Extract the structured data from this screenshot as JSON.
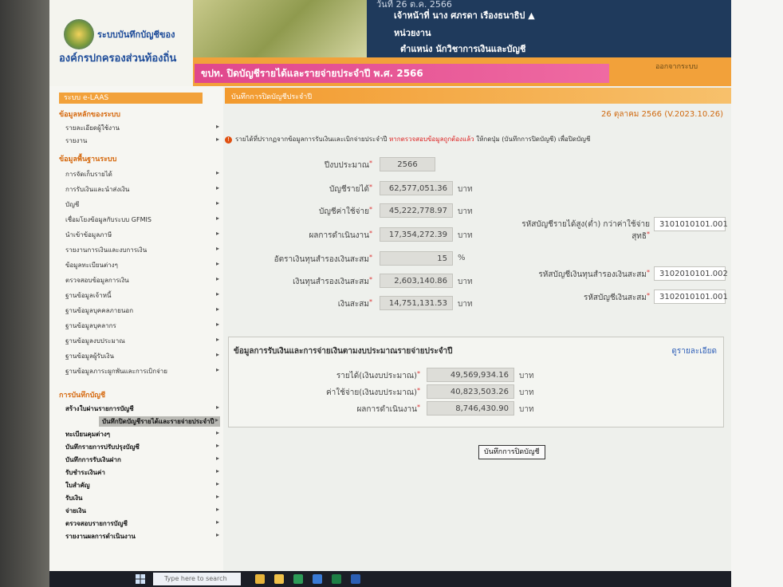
{
  "header": {
    "logo_text_1": "ระบบบันทึกบัญชีของ",
    "logo_text_2": "องค์กรปกครองส่วนท้องถิ่น",
    "user_line_0": "วันที่ 26 ต.ค. 2566",
    "user_name": "เจ้าหน้าที่ นาง ศภรดา เรืองธนาธิป",
    "unit_label": "หน่วยงาน",
    "position": "ตำแหน่ง นักวิชาการเงินและบัญชี",
    "page_title": "ขปท. ปิดบัญชีรายได้และรายจ่ายประจำปี พ.ศ. 2566",
    "right_link": "ออกจากระบบ"
  },
  "sidebar": {
    "top_label": "ระบบ e-LAAS",
    "section_1": "ข้อมูลหลักของระบบ",
    "items_a": [
      "รายละเอียดผู้ใช้งาน",
      "รายงาน"
    ],
    "section_2": "ข้อมูลพื้นฐานระบบ",
    "items_b": [
      "การจัดเก็บรายได้",
      "การรับเงินและนำส่งเงิน",
      "บัญชี",
      "เชื่อมโยงข้อมูลกับระบบ GFMIS",
      "นำเข้าข้อมูลภาษี",
      "รายงานการเงินและงบการเงิน",
      "ข้อมูลทะเบียนต่างๆ",
      "ตรวจสอบข้อมูลการเงิน",
      "ฐานข้อมูลเจ้าหนี้",
      "ฐานข้อมูลบุคคลภายนอก",
      "ฐานข้อมูลบุคลากร",
      "ฐานข้อมูลงบประมาณ",
      "ฐานข้อมูลผู้รับเงิน",
      "ฐานข้อมูลภาระผูกพันและการเบิกจ่าย"
    ],
    "section_3": "การบันทึกบัญชี",
    "items_c": [
      "สร้างใบผ่านรายการบัญชี",
      "บันทึกปิดบัญชีรายได้และรายจ่ายประจำปี",
      "ทะเบียนคุมต่างๆ",
      "บันทึกรายการปรับปรุงบัญชี",
      "บันทึกการรับเงินฝาก",
      "รับชำระเงินค่า",
      "ใบสำคัญ",
      "รับเงิน",
      "จ่ายเงิน",
      "ตรวจสอบรายการบัญชี",
      "รายงานผลการดำเนินงาน"
    ]
  },
  "main": {
    "breadcrumb": "บันทึกการปิดบัญชีประจำปี",
    "date": "26 ตุลาคม 2566 (V.2023.10.26)",
    "warning_text": "รายได้ที่ปรากฏจากข้อมูลการรับเงินและเบิกจ่ายประจำปี",
    "warning_red": "หากตรวจสอบข้อมูลถูกต้องแล้ว",
    "warning_tail": "ให้กดปุ่ม (บันทึกการปิดบัญชี) เพื่อปิดบัญชี",
    "fields": {
      "budget_year_label": "ปีงบประมาณ",
      "budget_year": "2566",
      "revenue_label": "บัญชีรายได้",
      "revenue": "62,577,051.36",
      "expense_label": "บัญชีค่าใช้จ่าย",
      "expense": "45,222,778.97",
      "result_label": "ผลการดำเนินงาน",
      "result": "17,354,272.39",
      "reserve_rate_label": "อัตราเงินทุนสำรองเงินสะสม",
      "reserve_rate": "15",
      "reserve_label": "เงินทุนสำรองเงินสะสม",
      "reserve": "2,603,140.86",
      "accum_label": "เงินสะสม",
      "accum": "14,751,131.53",
      "unit": "บาท",
      "percent": "%",
      "code1_label": "รหัสบัญชีรายได้สูง(ต่ำ) กว่าค่าใช้จ่ายสุทธิ",
      "code1": "3101010101.001",
      "code2_label": "รหัสบัญชีเงินทุนสำรองเงินสะสม",
      "code2": "3102010101.002",
      "code3_label": "รหัสบัญชีเงินสะสม",
      "code3": "3102010101.001"
    },
    "panel": {
      "title": "ข้อมูลการรับเงินและการจ่ายเงินตามงบประมาณรายจ่ายประจำปี",
      "link": "ดูรายละเอียด",
      "income_label": "รายได้(เงินงบประมาณ)",
      "income": "49,569,934.16",
      "spend_label": "ค่าใช้จ่าย(เงินงบประมาณ)",
      "spend": "40,823,503.26",
      "net_label": "ผลการดำเนินงาน",
      "net": "8,746,430.90",
      "unit": "บาท"
    },
    "save_button": "บันทึกการปิดบัญชี"
  },
  "taskbar": {
    "search_placeholder": "Type here to search"
  }
}
